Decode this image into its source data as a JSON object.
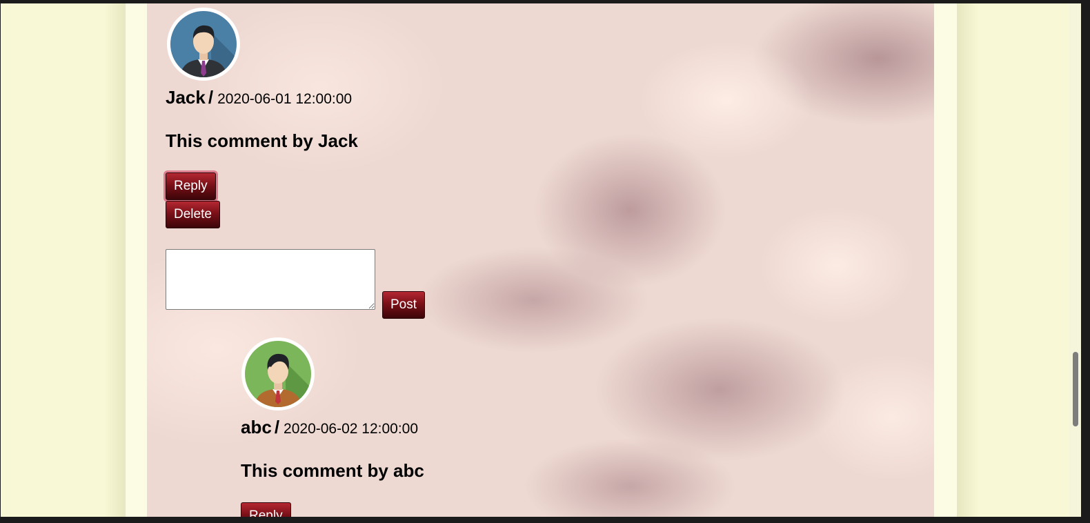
{
  "comments": [
    {
      "author": "Jack",
      "separator": "/",
      "timestamp": "2020-06-01 12:00:00",
      "text": "This comment by Jack",
      "avatar_icon": "male-avatar-icon",
      "reply_label": "Reply",
      "delete_label": "Delete",
      "post_label": "Post",
      "reply_input_value": ""
    },
    {
      "author": "abc",
      "separator": "/",
      "timestamp": "2020-06-02 12:00:00",
      "text": "This comment by abc",
      "avatar_icon": "male-avatar-icon",
      "reply_label": "Reply"
    }
  ],
  "colors": {
    "page_background": "#f8f8d6",
    "button_gradient_top": "#b42832",
    "button_gradient_bottom": "#3c0508",
    "button_text": "#ffffff",
    "avatar1_background": "#4a7fa6",
    "avatar2_background": "#7cb65a"
  }
}
